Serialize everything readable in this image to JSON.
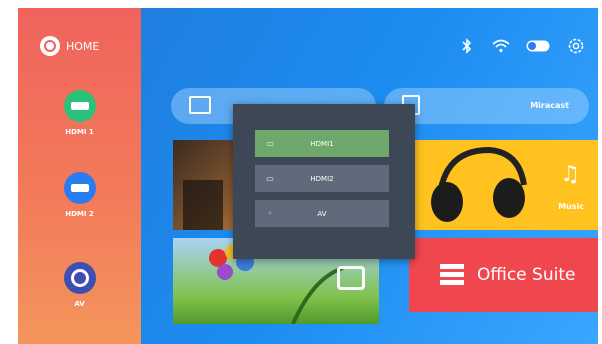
{
  "sidebar": {
    "home_label": "HOME",
    "sources": [
      {
        "label": "HDMI 1",
        "icon": "hdmi-plug-icon"
      },
      {
        "label": "HDMI 2",
        "icon": "hdmi-plug-icon"
      },
      {
        "label": "AV",
        "icon": "av-ring-icon"
      }
    ]
  },
  "status_icons": [
    "bluetooth-icon",
    "wifi-icon",
    "toggle-icon",
    "settings-gear-icon"
  ],
  "top_tiles": [
    {
      "label": "",
      "icon": "screen-mirror-icon"
    },
    {
      "label": "Miracast",
      "icon": "cast-icon"
    }
  ],
  "tiles": [
    {
      "label": "",
      "icon": "movie-icon"
    },
    {
      "label": "Music",
      "icon": "music-note-icon"
    },
    {
      "label": "",
      "icon": "photo-icon"
    },
    {
      "label": "Office Suite",
      "icon": "document-icon"
    }
  ],
  "source_popup": {
    "options": [
      {
        "label": "HDMI1",
        "selected": true
      },
      {
        "label": "HDMI2",
        "selected": false
      },
      {
        "label": "AV",
        "selected": false
      }
    ]
  },
  "colors": {
    "sidebar_top": "#f0635d",
    "main_bg": "#1d8cf0",
    "popup_bg": "#3d4756",
    "selected_option": "#6ea86c",
    "office_tile": "#f0474f",
    "music_tile": "#ffc21e"
  }
}
